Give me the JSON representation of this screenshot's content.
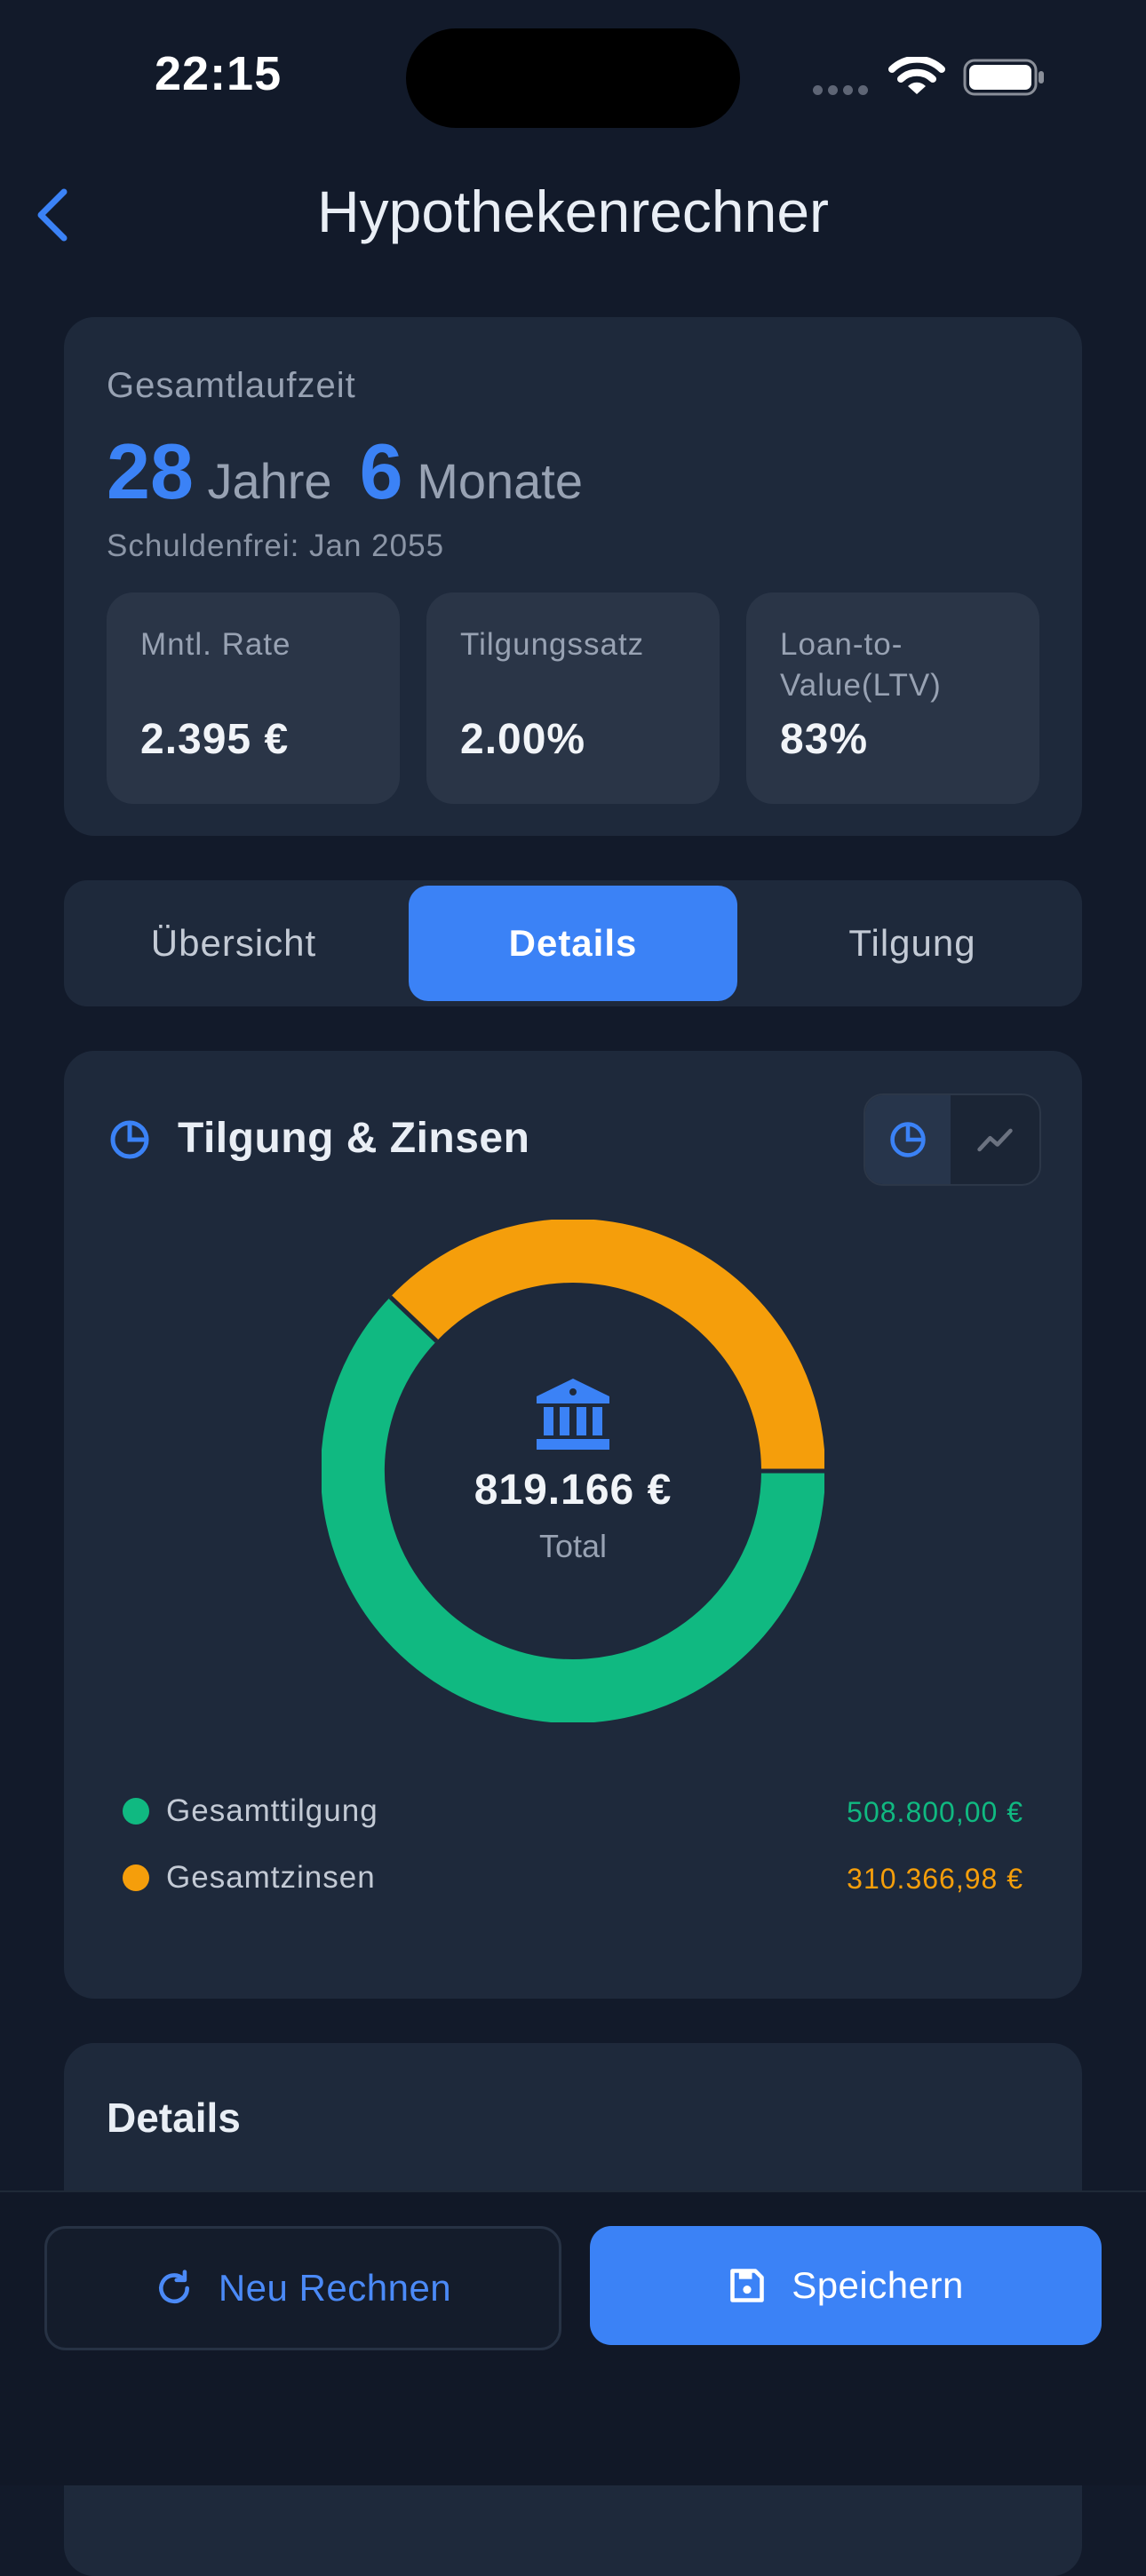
{
  "status_bar": {
    "time": "22:15"
  },
  "header": {
    "title": "Hypothekenrechner"
  },
  "summary": {
    "label": "Gesamtlaufzeit",
    "years_value": "28",
    "years_unit": "Jahre",
    "months_value": "6",
    "months_unit": "Monate",
    "debt_free": "Schuldenfrei: Jan 2055",
    "stats": [
      {
        "label": "Mntl. Rate",
        "value": "2.395 €"
      },
      {
        "label": "Tilgungssatz",
        "value": "2.00%"
      },
      {
        "label": "Loan-to-Value(LTV)",
        "value": "83%"
      }
    ]
  },
  "tabs": [
    {
      "label": "Übersicht",
      "active": false
    },
    {
      "label": "Details",
      "active": true
    },
    {
      "label": "Tilgung",
      "active": false
    }
  ],
  "chart_card": {
    "title": "Tilgung & Zinsen",
    "icons": {
      "title": "pie-chart-icon",
      "toggle_pie": "pie-chart-icon",
      "toggle_line": "line-chart-icon",
      "center": "bank-icon"
    },
    "center_total": "819.166 €",
    "center_label": "Total",
    "legend": [
      {
        "label": "Gesamttilgung",
        "value": "508.800,00 €",
        "color": "#10b981"
      },
      {
        "label": "Gesamtzinsen",
        "value": "310.366,98 €",
        "color": "#f59e0b"
      }
    ]
  },
  "chart_data": {
    "type": "pie",
    "categories": [
      "Gesamttilgung",
      "Gesamtzinsen"
    ],
    "values": [
      508800.0,
      310366.98
    ],
    "colors": [
      "#10b981",
      "#f59e0b"
    ],
    "title": "Tilgung & Zinsen"
  },
  "details": {
    "title": "Details"
  },
  "bottom_bar": {
    "recalc_label": "Neu Rechnen",
    "save_label": "Speichern",
    "icons": {
      "recalc": "refresh-icon",
      "save": "save-icon"
    }
  },
  "colors": {
    "accent": "#3b82f6",
    "background": "#121a2a",
    "card": "#1e293b"
  }
}
